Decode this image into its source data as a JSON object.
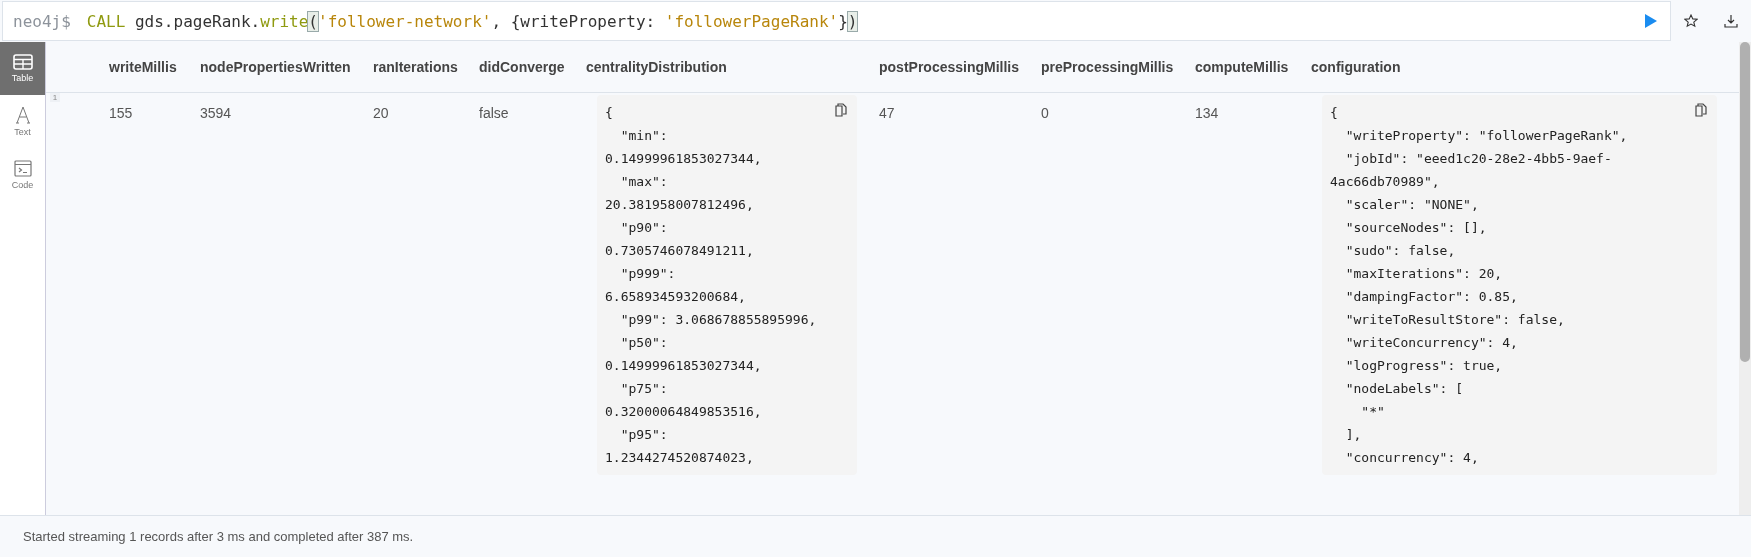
{
  "query": {
    "prompt": "neo4j$",
    "tokens": [
      {
        "text": "CALL",
        "kind": "keyword"
      },
      {
        "text": " gds.pageRank.",
        "kind": "plain"
      },
      {
        "text": "write",
        "kind": "keyword"
      },
      {
        "text": "(",
        "kind": "bracket"
      },
      {
        "text": "'follower-network'",
        "kind": "string"
      },
      {
        "text": ", {writeProperty: ",
        "kind": "plain"
      },
      {
        "text": "'followerPageRank'",
        "kind": "string"
      },
      {
        "text": "}",
        "kind": "plain"
      },
      {
        "text": ")",
        "kind": "bracket"
      }
    ]
  },
  "sidebar": {
    "items": [
      {
        "label": "Table",
        "kind": "table",
        "selected": true
      },
      {
        "label": "Text",
        "kind": "text",
        "selected": false
      },
      {
        "label": "Code",
        "kind": "code",
        "selected": false
      }
    ]
  },
  "table": {
    "columns": [
      "writeMillis",
      "nodePropertiesWritten",
      "ranIterations",
      "didConverge",
      "centralityDistribution",
      "postProcessingMillis",
      "preProcessingMillis",
      "computeMillis",
      "configuration"
    ],
    "rows": [
      {
        "index": "1",
        "cells": [
          {
            "kind": "text",
            "text": "155"
          },
          {
            "kind": "text",
            "text": "3594"
          },
          {
            "kind": "text",
            "text": "20"
          },
          {
            "kind": "text",
            "text": "false"
          },
          {
            "kind": "code",
            "lines": [
              "{",
              "  \"min\":",
              "0.14999961853027344,",
              "  \"max\":",
              "20.381958007812496,",
              "  \"p90\":",
              "0.7305746078491211,",
              "  \"p999\":",
              "6.658934593200684,",
              "  \"p99\": 3.068678855895996,",
              "  \"p50\":",
              "0.14999961853027344,",
              "  \"p75\":",
              "0.32000064849853516,",
              "  \"p95\":",
              "1.2344274520874023,"
            ]
          },
          {
            "kind": "text",
            "text": "47"
          },
          {
            "kind": "text",
            "text": "0"
          },
          {
            "kind": "text",
            "text": "134"
          },
          {
            "kind": "code",
            "lines": [
              "{",
              "  \"writeProperty\": \"followerPageRank\",",
              "  \"jobId\": \"eeed1c20-28e2-4bb5-9aef-",
              "4ac66db70989\",",
              "  \"scaler\": \"NONE\",",
              "  \"sourceNodes\": [],",
              "  \"sudo\": false,",
              "  \"maxIterations\": 20,",
              "  \"dampingFactor\": 0.85,",
              "  \"writeToResultStore\": false,",
              "  \"writeConcurrency\": 4,",
              "  \"logProgress\": true,",
              "  \"nodeLabels\": [",
              "    \"*\"",
              "  ],",
              "  \"concurrency\": 4,"
            ]
          }
        ]
      }
    ]
  },
  "status_bar": "Started streaming 1 records after 3 ms and completed after 387 ms."
}
